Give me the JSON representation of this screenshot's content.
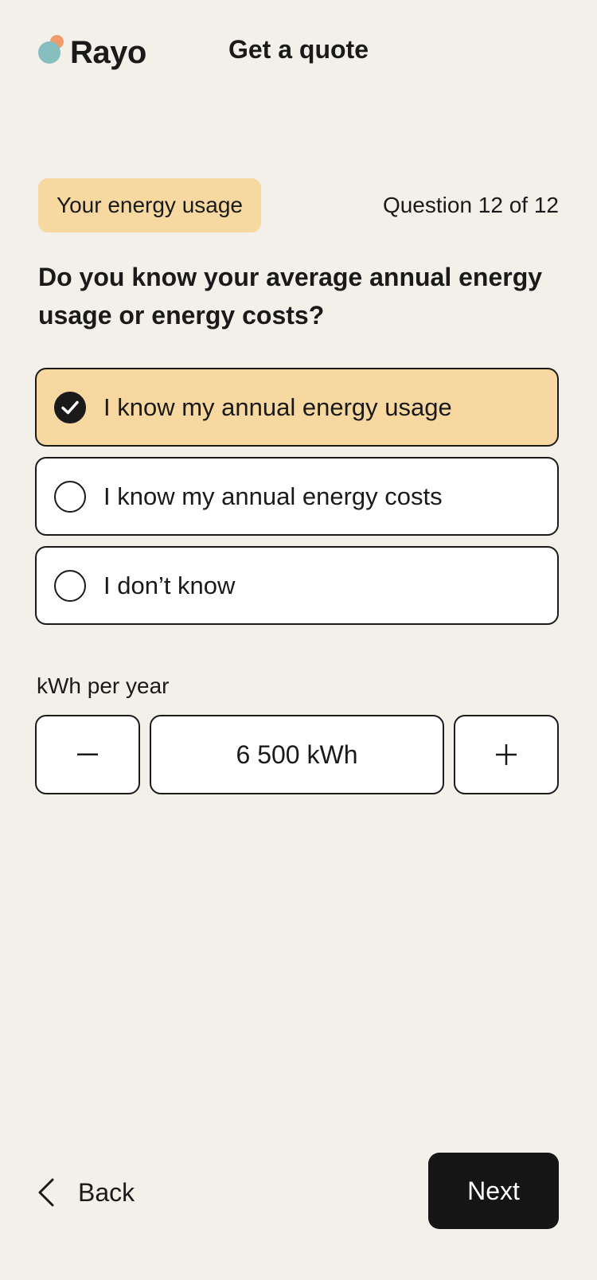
{
  "header": {
    "brand": "Rayo",
    "title": "Get a quote"
  },
  "section": {
    "badge": "Your energy usage",
    "counter": "Question 12 of 12"
  },
  "question": {
    "text": "Do you know your average annual energy usage or energy costs?",
    "options": [
      {
        "label": "I know my annual energy usage",
        "selected": true
      },
      {
        "label": "I know my annual energy costs",
        "selected": false
      },
      {
        "label": "I don’t know",
        "selected": false
      }
    ]
  },
  "stepper": {
    "label": "kWh per year",
    "value": "6 500 kWh",
    "minus_symbol": "–",
    "plus_symbol": "+"
  },
  "footer": {
    "back_label": "Back",
    "next_label": "Next"
  },
  "colors": {
    "background": "#f3f0ea",
    "accent": "#f6d8a0",
    "primary_button": "#151515",
    "logo_orange": "#f39a6b",
    "logo_teal": "#86bdbf"
  },
  "icons": {
    "selected_option": "check-circle-icon",
    "unselected_option": "radio-empty-icon",
    "back": "chevron-left-icon"
  }
}
